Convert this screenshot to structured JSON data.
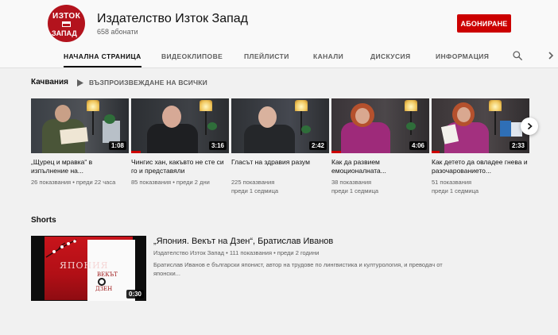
{
  "channel": {
    "name": "Издателство Изток Запад",
    "subscribers": "658 абонати",
    "subscribe_label": "АБОНИРАНЕ",
    "logo_top": "ИЗТОК",
    "logo_bottom": "ЗАПАД"
  },
  "tabs": [
    {
      "label": "НАЧАЛНА СТРАНИЦА",
      "active": true
    },
    {
      "label": "ВИДЕОКЛИПОВЕ"
    },
    {
      "label": "ПЛЕЙЛИСТИ"
    },
    {
      "label": "КАНАЛИ"
    },
    {
      "label": "ДИСКУСИЯ"
    },
    {
      "label": "ИНФОРМАЦИЯ"
    }
  ],
  "uploads": {
    "title": "Качвания",
    "play_all": "ВЪЗПРОИЗВЕЖДАНЕ НА ВСИЧКИ",
    "videos": [
      {
        "title": "„Щурец и мравка“ в изпълнение на...",
        "views": "26 показвания",
        "date": "преди 22 часа",
        "duration": "1:08",
        "progress": 0
      },
      {
        "title": "Чингис хан, какъвто не сте си го и представяли",
        "views": "85 показвания",
        "date": "преди 2 дни",
        "duration": "3:16",
        "progress": 0.1
      },
      {
        "title": "Гласът на здравия разум",
        "views": "225 показвания",
        "date": "преди 1 седмица",
        "duration": "2:42",
        "progress": 0
      },
      {
        "title": "Как да развием емоционалната...",
        "views": "38 показвания",
        "date": "преди 1 седмица",
        "duration": "4:06",
        "progress": 0.1
      },
      {
        "title": "Как детето да овладее гнева и разочарованието...",
        "views": "51 показвания",
        "date": "преди 1 седмица",
        "duration": "2:33",
        "progress": 0.08
      }
    ]
  },
  "shorts": {
    "title": "Shorts",
    "item": {
      "title": "„Япония. Векът на Дзен“, Братислав Иванов",
      "meta": "Издателство Изток Запад • 111 показвания • преди 2 години",
      "description": "Братислав Иванов е български японист, автор на трудове по лингвистика и културология, и преводач от японски...",
      "duration": "0:30",
      "book_title": "ЯПОНИЯ",
      "book_sub": "ВЕКЪТ",
      "book_zen": "ДЗЕН"
    }
  },
  "colors": {
    "accent": "#cc0000",
    "text_secondary": "#606060",
    "background": "#f1f1f1"
  },
  "icons": {
    "search": "search-icon",
    "tabs_next": "chevron-right-icon",
    "play_all": "play-icon",
    "carousel_next": "chevron-right-icon"
  }
}
